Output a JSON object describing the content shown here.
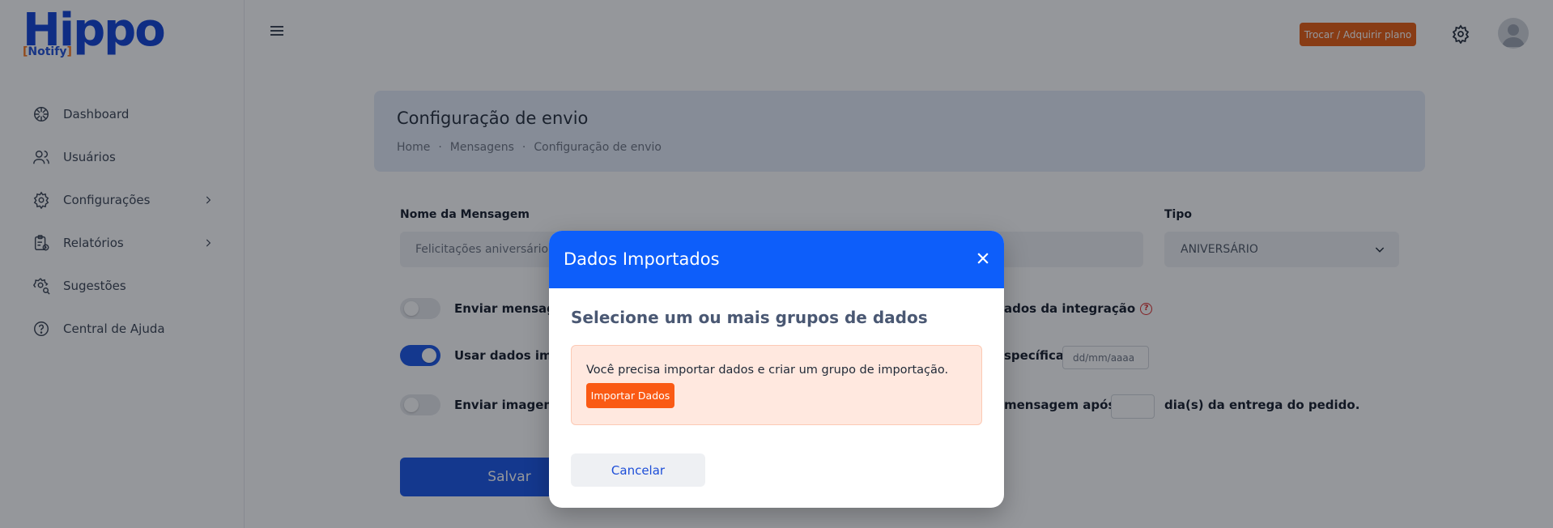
{
  "brand": {
    "logo_word": "Hippo",
    "logo_sub_open": "[",
    "logo_sub": "Notify",
    "logo_sub_close": "]"
  },
  "sidebar": {
    "items": [
      {
        "label": "Dashboard",
        "icon": "dashboard-icon",
        "has_submenu": false
      },
      {
        "label": "Usuários",
        "icon": "users-icon",
        "has_submenu": false
      },
      {
        "label": "Configurações",
        "icon": "gear-icon",
        "has_submenu": true
      },
      {
        "label": "Relatórios",
        "icon": "clipboard-icon",
        "has_submenu": true
      },
      {
        "label": "Sugestões",
        "icon": "gear-search-icon",
        "has_submenu": false
      },
      {
        "label": "Central de Ajuda",
        "icon": "help-circle-icon",
        "has_submenu": false
      }
    ]
  },
  "topbar": {
    "plan_button": "Trocar / Adquirir plano"
  },
  "page": {
    "title": "Configuração de envio",
    "breadcrumb": [
      "Home",
      "Mensagens",
      "Configuração de envio"
    ],
    "breadcrumb_separator": "·"
  },
  "form": {
    "name_label": "Nome da Mensagem",
    "name_value": "Felicitações aniversário cl",
    "type_label": "Tipo",
    "type_value": "ANIVERSÁRIO",
    "options": [
      {
        "left_text": "Enviar mensage",
        "right_text": "ados da integração",
        "toggle_on": false
      },
      {
        "left_text": "Usar dados impo",
        "right_text": "specífica",
        "toggle_on": true
      },
      {
        "left_text": "Enviar imagem j",
        "right_text": "mensagem após",
        "toggle_on": false
      }
    ],
    "date_placeholder": "dd/mm/aaaa",
    "days_suffix": "dia(s) da entrega do pedido.",
    "save_label": "Salvar"
  },
  "modal": {
    "title": "Dados Importados",
    "subtitle": "Selecione um ou mais grupos de dados",
    "alert_text": "Você precisa importar dados e criar um grupo de importação.",
    "import_button": "Importar Dados",
    "cancel_button": "Cancelar"
  },
  "colors": {
    "primary": "#0d5efa",
    "accent_orange": "#fa5a14",
    "plan_button": "#e8590c",
    "alert_bg": "#ffe8df"
  }
}
